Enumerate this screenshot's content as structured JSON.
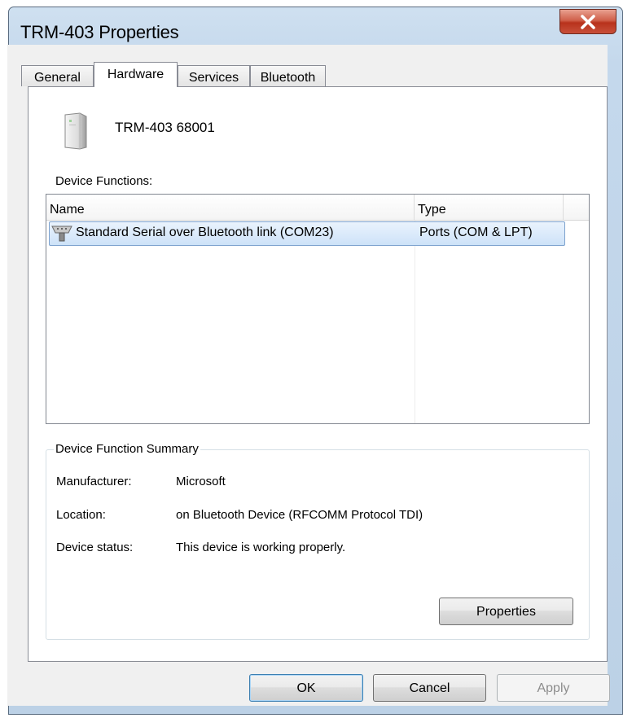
{
  "window": {
    "title": "TRM-403 Properties"
  },
  "tabs": [
    {
      "label": "General"
    },
    {
      "label": "Hardware"
    },
    {
      "label": "Services"
    },
    {
      "label": "Bluetooth"
    }
  ],
  "device": {
    "name": "TRM-403  68001",
    "icon": "device-tower-icon"
  },
  "functions": {
    "label": "Device Functions:",
    "columns": [
      "Name",
      "Type"
    ],
    "rows": [
      {
        "name": "Standard Serial over Bluetooth link (COM23)",
        "type": "Ports (COM & LPT)",
        "icon": "serial-port-icon",
        "selected": true
      }
    ]
  },
  "summary": {
    "title": "Device Function Summary",
    "fields": [
      {
        "label": "Manufacturer:",
        "value": "Microsoft"
      },
      {
        "label": "Location:",
        "value": "on Bluetooth Device (RFCOMM Protocol TDI)"
      },
      {
        "label": "Device status:",
        "value": "This device is working properly."
      }
    ],
    "properties_button": "Properties"
  },
  "buttons": {
    "ok": "OK",
    "cancel": "Cancel",
    "apply": "Apply"
  },
  "colors": {
    "selection_border": "#7da2ce",
    "selection_fill": "#cde2f8",
    "close_button": "#c8503a",
    "frame": "#bcd1e6"
  }
}
